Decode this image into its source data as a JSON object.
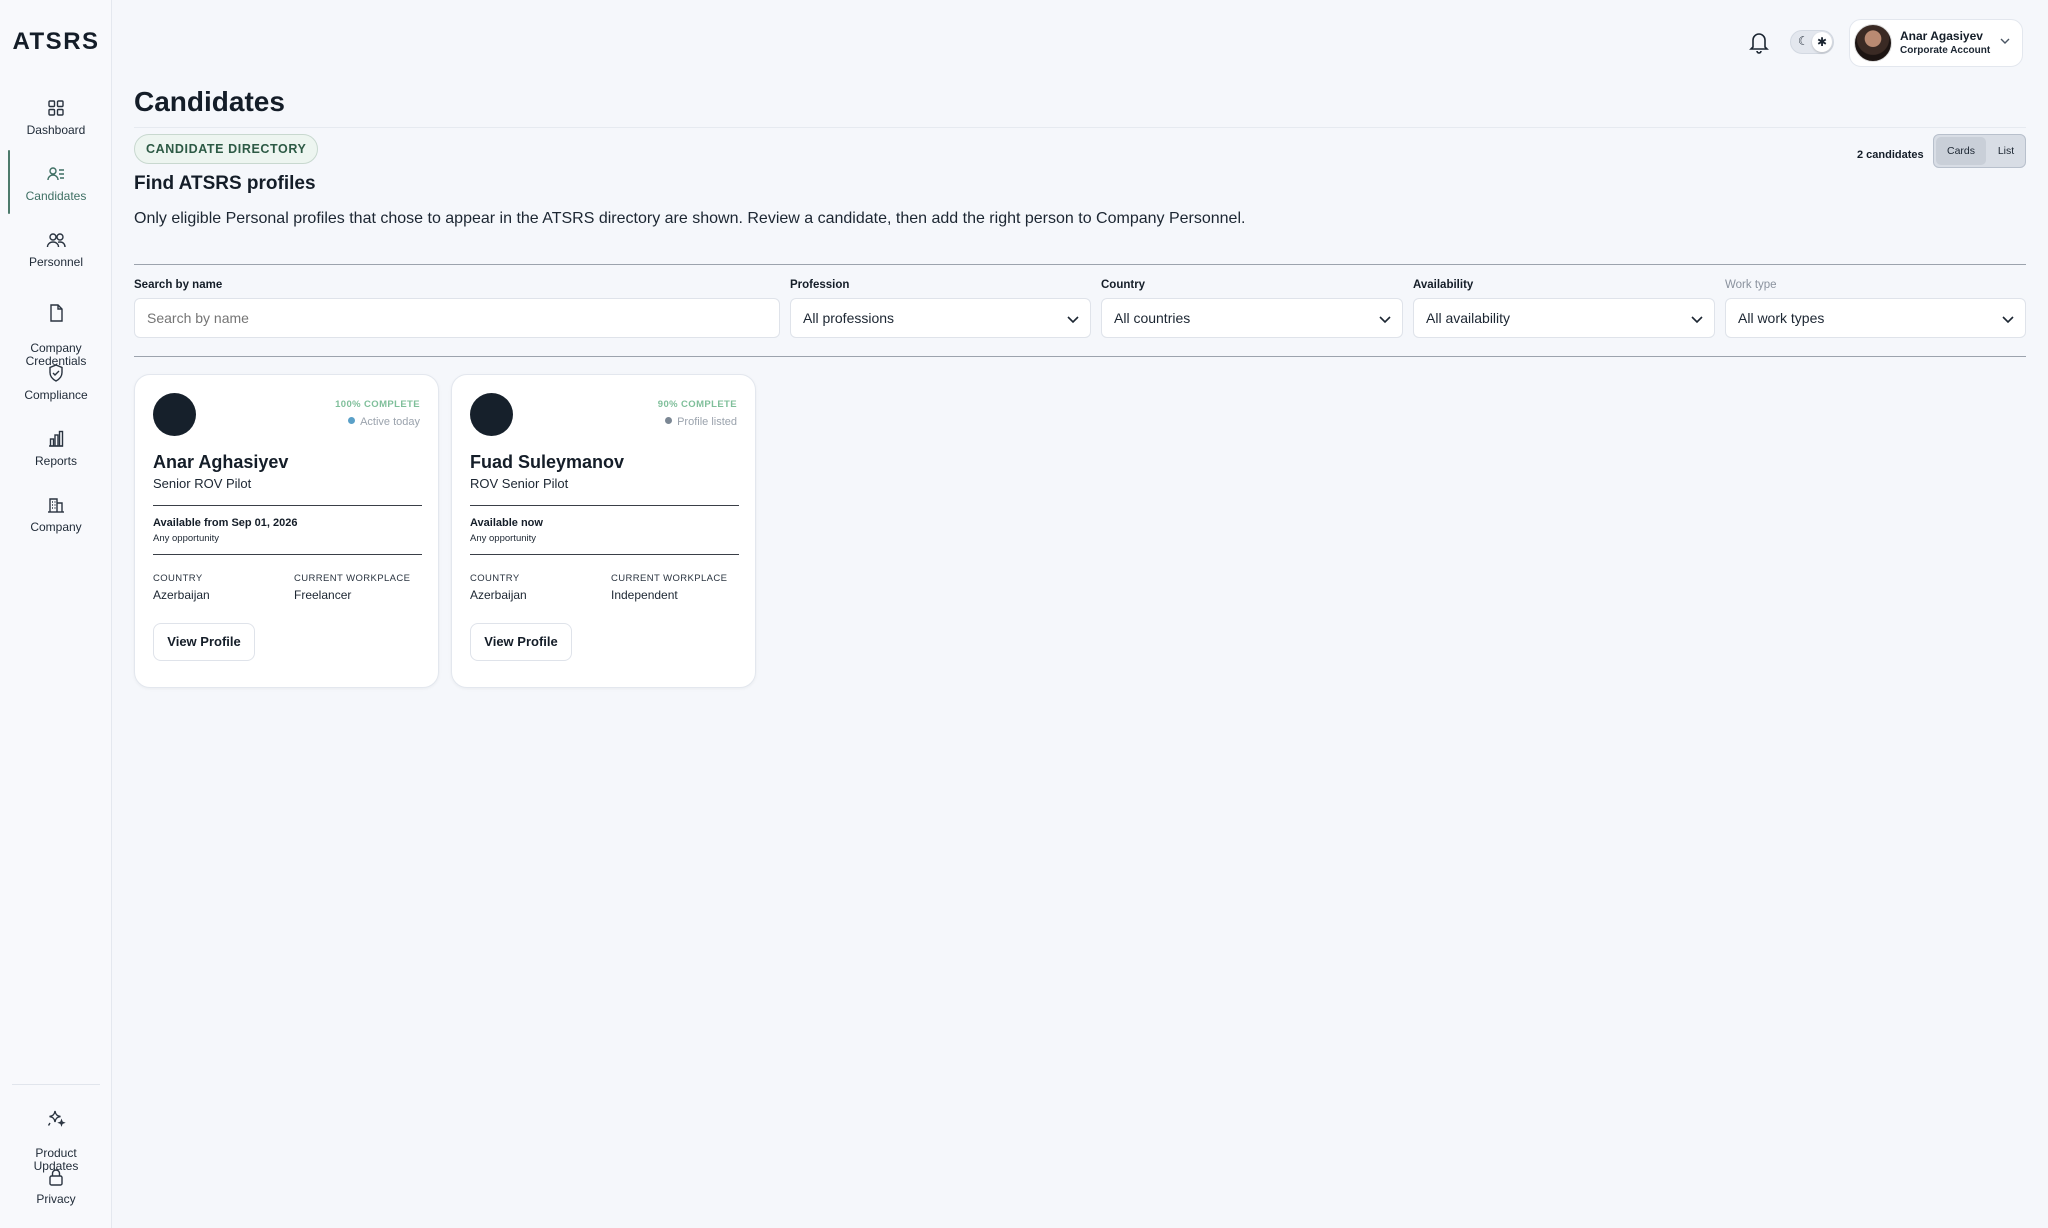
{
  "app": {
    "logo": "ATSRS"
  },
  "sidebar": {
    "items": [
      {
        "label": "Dashboard",
        "icon": "grid-icon"
      },
      {
        "label": "Candidates",
        "icon": "user-list-icon",
        "active": true
      },
      {
        "label": "Personnel",
        "icon": "users-icon"
      },
      {
        "label": "Company\nCredentials",
        "icon": "document-icon"
      },
      {
        "label": "Compliance",
        "icon": "shield-check-icon"
      },
      {
        "label": "Reports",
        "icon": "bar-chart-icon"
      },
      {
        "label": "Company",
        "icon": "building-icon"
      }
    ],
    "bottom_items": [
      {
        "label": "Product\nUpdates",
        "icon": "sparkle-icon"
      },
      {
        "label": "Privacy",
        "icon": "lock-icon"
      }
    ]
  },
  "topbar": {
    "user_name": "Anar Agasiyev",
    "user_role": "Corporate Account",
    "theme_icons": {
      "moon": "☾",
      "sun": "✱"
    }
  },
  "header": {
    "page_title": "Candidates",
    "badge": "CANDIDATE DIRECTORY",
    "section_title": "Find ATSRS profiles",
    "description": "Only eligible Personal profiles that chose to appear in the ATSRS directory are shown. Review a candidate, then add the right person to Company Personnel.",
    "count": "2 candidates",
    "view_modes": [
      "Cards",
      "List"
    ],
    "active_view": "Cards"
  },
  "filters": {
    "search": {
      "label": "Search by name",
      "placeholder": "Search by name"
    },
    "profession": {
      "label": "Profession",
      "value": "All professions"
    },
    "country": {
      "label": "Country",
      "value": "All countries"
    },
    "availability": {
      "label": "Availability",
      "value": "All availability"
    },
    "work_type": {
      "label": "Work type",
      "value": "All work types"
    }
  },
  "candidates": [
    {
      "name": "Anar Aghasiyev",
      "role": "Senior ROV Pilot",
      "completeness": "100% COMPLETE",
      "status": "Active today",
      "status_color": "#5aa0c8",
      "availability": "Available from Sep 01, 2026",
      "opportunity": "Any opportunity",
      "country_label": "COUNTRY",
      "country": "Azerbaijan",
      "workplace_label": "CURRENT WORKPLACE",
      "workplace": "Freelancer",
      "action": "View Profile"
    },
    {
      "name": "Fuad Suleymanov",
      "role": "ROV Senior Pilot",
      "completeness": "90% COMPLETE",
      "status": "Profile listed",
      "status_color": "#7b8794",
      "availability": "Available now",
      "opportunity": "Any opportunity",
      "country_label": "COUNTRY",
      "country": "Azerbaijan",
      "workplace_label": "CURRENT WORKPLACE",
      "workplace": "Independent",
      "action": "View Profile"
    }
  ]
}
